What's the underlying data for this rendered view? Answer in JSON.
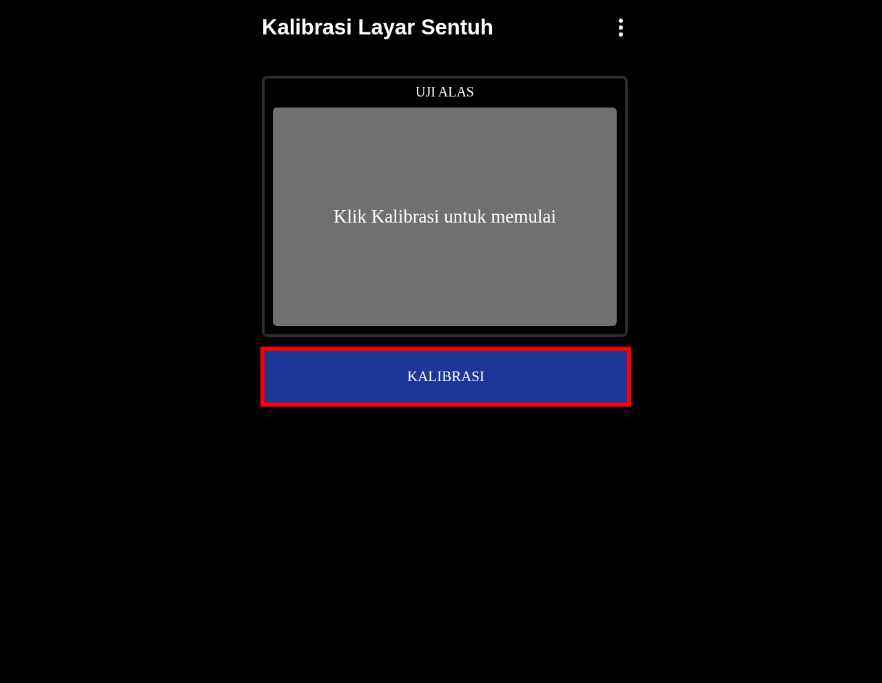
{
  "app_bar": {
    "title": "Kalibrasi Layar Sentuh"
  },
  "test_card": {
    "title": "UJI ALAS",
    "message": "Klik Kalibrasi untuk memulai"
  },
  "calibrate_button": {
    "label": "KALIBRASI",
    "highlighted": true
  }
}
